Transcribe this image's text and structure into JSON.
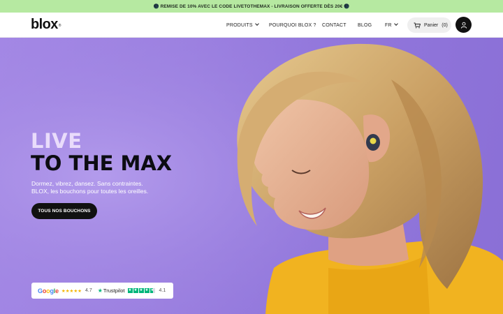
{
  "announcement": "🌑 REMISE DE 10% AVEC LE CODE LIVETOTHEMAX - LIVRAISON OFFERTE DÈS 20€ 🌑",
  "header": {
    "logo": "blox",
    "logo_mark": "®",
    "nav": [
      {
        "label": "PRODUITS",
        "has_dropdown": true
      },
      {
        "label": "POURQUOI BLOX ?",
        "has_dropdown": false
      },
      {
        "label": "CONTACT",
        "has_dropdown": false
      },
      {
        "label": "BLOG",
        "has_dropdown": false
      },
      {
        "label": "FR",
        "has_dropdown": true
      }
    ],
    "cart_label": "Panier",
    "cart_count": "(0)",
    "icons": {
      "cart": "cart-icon",
      "account": "user-icon"
    }
  },
  "hero": {
    "headline_1": "LIVE",
    "headline_2": "TO THE MAX",
    "subtitle_line1": "Dormez, vibrez, dansez. Sans contraintes.",
    "subtitle_line2": "BLOX, les bouchons pour toutes les oreilles.",
    "cta": "TOUS NOS BOUCHONS",
    "background_color": "#9b80e0"
  },
  "reviews": {
    "google_label": "Google",
    "google_stars": "★★★★★",
    "google_rating": "4.7",
    "trustpilot_label": "Trustpilot",
    "trustpilot_rating": "4.1"
  },
  "colors": {
    "accent_purple": "#9b80e0",
    "headline_light": "#e9dcfb",
    "topbar_green": "#b6e9a1",
    "trustpilot_green": "#00b67a",
    "google_star": "#f4b400"
  }
}
